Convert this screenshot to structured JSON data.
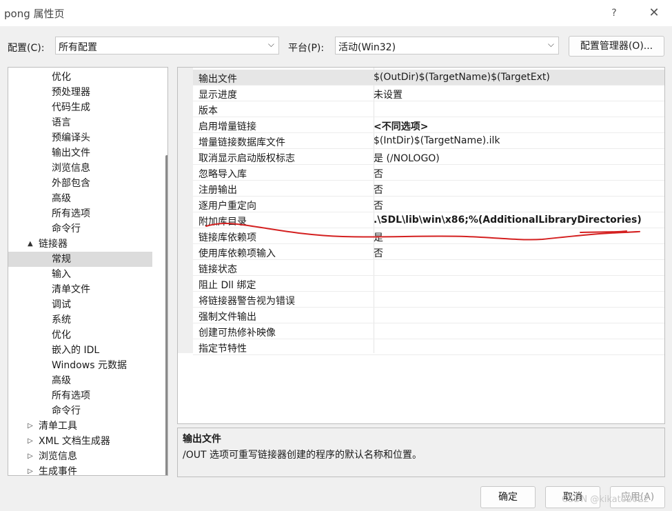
{
  "window": {
    "title": "pong 属性页",
    "help_glyph": "?",
    "close_glyph": "✕"
  },
  "config": {
    "label": "配置(C):",
    "value": "所有配置",
    "platform_label": "平台(P):",
    "platform_value": "活动(Win32)",
    "manager_button": "配置管理器(O)..."
  },
  "tree": {
    "items": [
      {
        "label": "优化",
        "level": 3
      },
      {
        "label": "预处理器",
        "level": 3
      },
      {
        "label": "代码生成",
        "level": 3
      },
      {
        "label": "语言",
        "level": 3
      },
      {
        "label": "预编译头",
        "level": 3
      },
      {
        "label": "输出文件",
        "level": 3
      },
      {
        "label": "浏览信息",
        "level": 3
      },
      {
        "label": "外部包含",
        "level": 3
      },
      {
        "label": "高级",
        "level": 3
      },
      {
        "label": "所有选项",
        "level": 3
      },
      {
        "label": "命令行",
        "level": 3
      },
      {
        "label": "链接器",
        "level": 2,
        "expander": "▲"
      },
      {
        "label": "常规",
        "level": 3,
        "selected": true
      },
      {
        "label": "输入",
        "level": 3
      },
      {
        "label": "清单文件",
        "level": 3
      },
      {
        "label": "调试",
        "level": 3
      },
      {
        "label": "系统",
        "level": 3
      },
      {
        "label": "优化",
        "level": 3
      },
      {
        "label": "嵌入的 IDL",
        "level": 3
      },
      {
        "label": "Windows 元数据",
        "level": 3
      },
      {
        "label": "高级",
        "level": 3
      },
      {
        "label": "所有选项",
        "level": 3
      },
      {
        "label": "命令行",
        "level": 3
      },
      {
        "label": "清单工具",
        "level": 2,
        "expander": "▷"
      },
      {
        "label": "XML 文档生成器",
        "level": 2,
        "expander": "▷"
      },
      {
        "label": "浏览信息",
        "level": 2,
        "expander": "▷"
      },
      {
        "label": "生成事件",
        "level": 2,
        "expander": "▷"
      }
    ]
  },
  "properties": {
    "rows": [
      {
        "name": "输出文件",
        "value": "$(OutDir)$(TargetName)$(TargetExt)",
        "highlight": true
      },
      {
        "name": "显示进度",
        "value": "未设置"
      },
      {
        "name": "版本",
        "value": ""
      },
      {
        "name": "启用增量链接",
        "value": "<不同选项>",
        "bold": true
      },
      {
        "name": "增量链接数据库文件",
        "value": "$(IntDir)$(TargetName).ilk"
      },
      {
        "name": "取消显示启动版权标志",
        "value": "是 (/NOLOGO)"
      },
      {
        "name": "忽略导入库",
        "value": "否"
      },
      {
        "name": "注册输出",
        "value": "否"
      },
      {
        "name": "逐用户重定向",
        "value": "否"
      },
      {
        "name": "附加库目录",
        "value": ".\\SDL\\lib\\win\\x86;%(AdditionalLibraryDirectories)",
        "bold": true
      },
      {
        "name": "链接库依赖项",
        "value": "是"
      },
      {
        "name": "使用库依赖项输入",
        "value": "否"
      },
      {
        "name": "链接状态",
        "value": ""
      },
      {
        "name": "阻止 Dll 绑定",
        "value": ""
      },
      {
        "name": "将链接器警告视为错误",
        "value": ""
      },
      {
        "name": "强制文件输出",
        "value": ""
      },
      {
        "name": "创建可热修补映像",
        "value": ""
      },
      {
        "name": "指定节特性",
        "value": ""
      }
    ]
  },
  "description": {
    "title": "输出文件",
    "text": "/OUT 选项可重写链接器创建的程序的默认名称和位置。"
  },
  "buttons": {
    "ok": "确定",
    "cancel": "取消",
    "apply": "应用(A)"
  },
  "watermark": "CSDN @kikato2022",
  "colors": {
    "annotation_stroke": "#d42020",
    "selection": "#dcdcdc"
  }
}
